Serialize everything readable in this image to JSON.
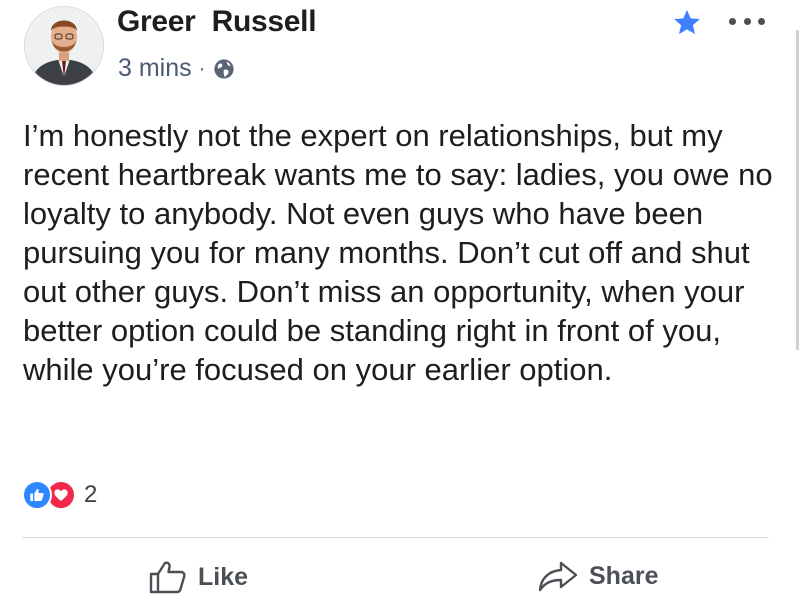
{
  "post": {
    "author": "Greer  Russell",
    "time": "3 mins",
    "separator": "·",
    "privacy_icon": "globe-icon",
    "text": "I’m honestly not the expert on relationships, but my recent heartbreak wants me to say: ladies, you owe no loyalty to anybody. Not even guys who have been pursuing you for many months. Don’t cut off and shut out other guys. Don’t miss an opportunity, when your better option could be standing right in front of you, while you’re focused on your earlier option."
  },
  "reactions": {
    "icons": [
      "like-reaction-icon",
      "love-reaction-icon"
    ],
    "count": "2"
  },
  "actions": {
    "like_label": "Like",
    "share_label": "Share"
  },
  "colors": {
    "accent_blue": "#4267b2",
    "star_blue": "#4080ff",
    "like_blue": "#2d88ff",
    "love_red": "#f0284a",
    "meta_text": "#4a5a73"
  }
}
